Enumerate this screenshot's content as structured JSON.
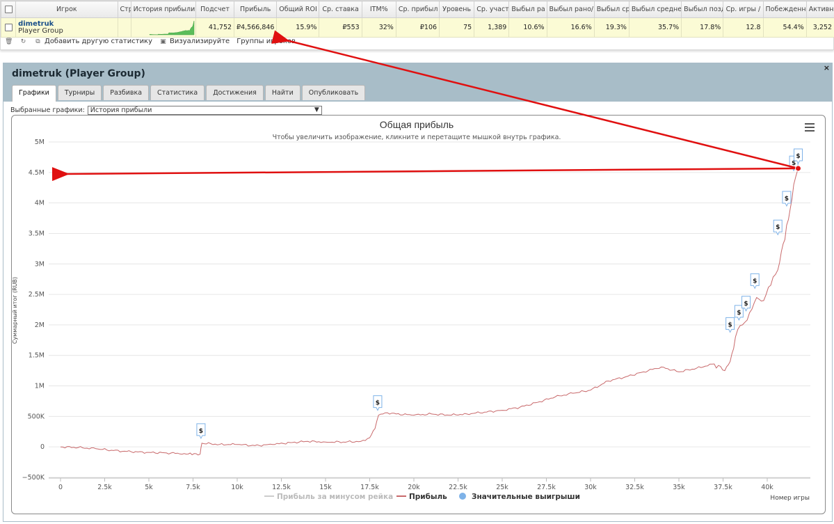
{
  "table": {
    "headers": [
      "Игрок",
      "Стр",
      "История прибыли",
      "Подсчет",
      "Прибыль",
      "Общий ROI",
      "Ср. ставка",
      "ITM%",
      "Ср. прибыл",
      "Уровень",
      "Ср. участ",
      "Выбыл ра",
      "Выбыл рано/",
      "Выбыл ср",
      "Выбыл средне",
      "Выбыл позд",
      "Ср. игры /",
      "Побежденн",
      "Активн"
    ],
    "row": {
      "player_name": "dimetruk",
      "player_group": "Player Group",
      "count": "41,752",
      "profit": "₽4,566,846",
      "roi": "15.9%",
      "avg_stake": "₽553",
      "itm": "32%",
      "avg_profit": "₽106",
      "level": "75",
      "avg_entrants": "1,389",
      "early_out": "10.6%",
      "early_mid_out": "16.6%",
      "mid_out": "19.3%",
      "mid_late_out": "35.7%",
      "late_out": "17.8%",
      "avg_games": "12.8",
      "beaten": "54.4%",
      "active": "3,252"
    }
  },
  "toolbar": {
    "add_stat": "Добавить другую статистику",
    "visualize": "Визуализируйте",
    "groups": "Группы игроков"
  },
  "panel": {
    "title": "dimetruk (Player Group)",
    "close": "×",
    "tabs": [
      "Графики",
      "Турниры",
      "Разбивка",
      "Статистика",
      "Достижения",
      "Найти",
      "Опубликовать"
    ],
    "select_label": "Выбранные графики:",
    "select_value": "История прибыли"
  },
  "colors": {
    "profit_line": "#c8686a",
    "arrow": "#e01010",
    "marker": "#7eb2e8",
    "sparkline": "#5bbd5b"
  },
  "chart_data": {
    "type": "line",
    "title": "Общая прибыль",
    "subtitle": "Чтобы увеличить изображение, кликните и перетащите мышкой внутрь графика.",
    "ylabel": "Суммарный итог (RUB)",
    "xlabel": "Номер игры",
    "ylim": [
      -500000,
      5000000
    ],
    "xlim": [
      0,
      42000
    ],
    "y_ticks": [
      {
        "v": -500000,
        "label": "−500K"
      },
      {
        "v": 0,
        "label": "0"
      },
      {
        "v": 500000,
        "label": "500K"
      },
      {
        "v": 1000000,
        "label": "1M"
      },
      {
        "v": 1500000,
        "label": "1.5M"
      },
      {
        "v": 2000000,
        "label": "2M"
      },
      {
        "v": 2500000,
        "label": "2.5M"
      },
      {
        "v": 3000000,
        "label": "3M"
      },
      {
        "v": 3500000,
        "label": "3.5M"
      },
      {
        "v": 4000000,
        "label": "4M"
      },
      {
        "v": 4500000,
        "label": "4.5M"
      },
      {
        "v": 5000000,
        "label": "5M"
      }
    ],
    "x_ticks": [
      {
        "v": 0,
        "label": "0"
      },
      {
        "v": 2500,
        "label": "2.5k"
      },
      {
        "v": 5000,
        "label": "5k"
      },
      {
        "v": 7500,
        "label": "7.5k"
      },
      {
        "v": 10000,
        "label": "10k"
      },
      {
        "v": 12500,
        "label": "12.5k"
      },
      {
        "v": 15000,
        "label": "15k"
      },
      {
        "v": 17500,
        "label": "17.5k"
      },
      {
        "v": 20000,
        "label": "20k"
      },
      {
        "v": 22500,
        "label": "22.5k"
      },
      {
        "v": 25000,
        "label": "25k"
      },
      {
        "v": 27500,
        "label": "27.5k"
      },
      {
        "v": 30000,
        "label": "30k"
      },
      {
        "v": 32500,
        "label": "32.5k"
      },
      {
        "v": 35000,
        "label": "35k"
      },
      {
        "v": 37500,
        "label": "37.5k"
      },
      {
        "v": 40000,
        "label": "40k"
      }
    ],
    "legend": [
      {
        "name": "Прибыль за минусом рейка",
        "hidden": true
      },
      {
        "name": "Прибыль"
      },
      {
        "name": "Значительные выигрыши"
      }
    ],
    "series": [
      {
        "name": "Прибыль",
        "points": [
          [
            0,
            0
          ],
          [
            1000,
            -10000
          ],
          [
            2000,
            -30000
          ],
          [
            3000,
            -60000
          ],
          [
            4000,
            -80000
          ],
          [
            5000,
            -90000
          ],
          [
            6000,
            -100000
          ],
          [
            7000,
            -110000
          ],
          [
            7900,
            -120000
          ],
          [
            8000,
            60000
          ],
          [
            9000,
            40000
          ],
          [
            10000,
            40000
          ],
          [
            11000,
            20000
          ],
          [
            12000,
            40000
          ],
          [
            13000,
            70000
          ],
          [
            14000,
            90000
          ],
          [
            15000,
            80000
          ],
          [
            16000,
            80000
          ],
          [
            17000,
            90000
          ],
          [
            17500,
            150000
          ],
          [
            17800,
            300000
          ],
          [
            18000,
            520000
          ],
          [
            18500,
            560000
          ],
          [
            19000,
            540000
          ],
          [
            20000,
            520000
          ],
          [
            21000,
            540000
          ],
          [
            22000,
            520000
          ],
          [
            23000,
            540000
          ],
          [
            24000,
            570000
          ],
          [
            25000,
            600000
          ],
          [
            26000,
            650000
          ],
          [
            27000,
            730000
          ],
          [
            28000,
            820000
          ],
          [
            29000,
            880000
          ],
          [
            30000,
            930000
          ],
          [
            31000,
            1080000
          ],
          [
            32000,
            1150000
          ],
          [
            33000,
            1230000
          ],
          [
            34000,
            1310000
          ],
          [
            35000,
            1230000
          ],
          [
            36000,
            1290000
          ],
          [
            37000,
            1360000
          ],
          [
            37600,
            1250000
          ],
          [
            37900,
            1400000
          ],
          [
            38200,
            1800000
          ],
          [
            38600,
            2000000
          ],
          [
            39000,
            2200000
          ],
          [
            39400,
            2450000
          ],
          [
            39800,
            2400000
          ],
          [
            40200,
            2650000
          ],
          [
            40600,
            2900000
          ],
          [
            40800,
            3200000
          ],
          [
            41000,
            3400000
          ],
          [
            41300,
            3900000
          ],
          [
            41500,
            4300000
          ],
          [
            41752,
            4566846
          ]
        ]
      }
    ],
    "markers": [
      {
        "x": 7950,
        "y": 60000
      },
      {
        "x": 17950,
        "y": 520000
      },
      {
        "x": 37900,
        "y": 1800000
      },
      {
        "x": 38400,
        "y": 2000000
      },
      {
        "x": 38800,
        "y": 2150000
      },
      {
        "x": 39300,
        "y": 2520000
      },
      {
        "x": 40600,
        "y": 3400000
      },
      {
        "x": 41100,
        "y": 3870000
      },
      {
        "x": 41500,
        "y": 4450000
      },
      {
        "x": 41752,
        "y": 4566846
      }
    ],
    "annotations": [
      "arrow from table profit cell to chart endpoint",
      "arrow from chart endpoint to 4.5M axis tick"
    ]
  }
}
